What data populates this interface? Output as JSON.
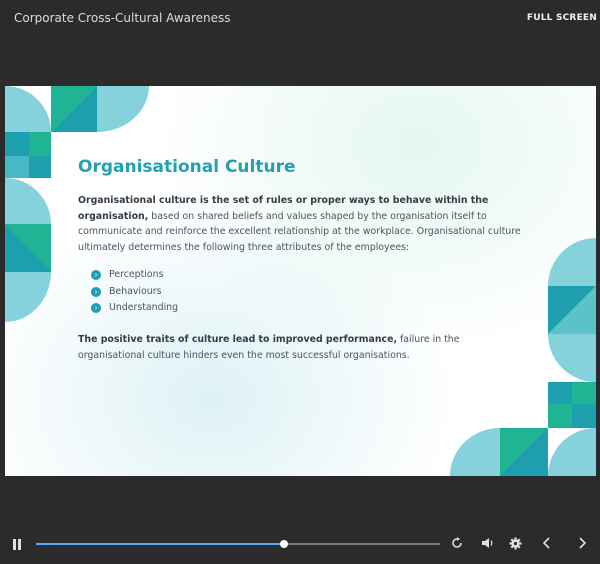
{
  "header": {
    "course_title": "Corporate Cross-Cultural Awareness",
    "fullscreen_label": "FULL SCREEN"
  },
  "slide": {
    "title": "Organisational Culture",
    "para1_bold": "Organisational culture is the set of rules or proper ways to behave within the organisation,",
    "para1_rest": " based on shared beliefs and values shaped by the organisation itself to communicate and reinforce the excellent relationship at the workplace. Organisational culture ultimately determines the following three attributes of the employees:",
    "bullets": [
      "Perceptions",
      "Behaviours",
      "Understanding"
    ],
    "para2_bold": "The positive traits of culture lead to improved performance,",
    "para2_rest": " failure in the organisational culture hinders even the most successful organisations."
  },
  "player": {
    "progress": 0.615,
    "icons": {
      "pause": "pause-icon",
      "replay": "replay-icon",
      "volume": "volume-icon",
      "settings": "gear-icon",
      "prev": "chevron-left-icon",
      "next": "chevron-right-icon"
    },
    "colors": {
      "progress_fill": "#55a9ff",
      "accent": "#1e9fb0"
    }
  }
}
